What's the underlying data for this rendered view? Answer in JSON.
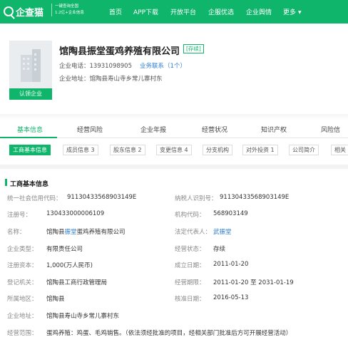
{
  "nav": {
    "logo_text": "企查猫",
    "logo_sub_line1": "一键查询全国",
    "logo_sub_line2": "1.2亿+企业信息",
    "items": [
      "首页",
      "APP下载",
      "开放平台",
      "企服优选",
      "企业舆情",
      "更多"
    ]
  },
  "header": {
    "company_name": "馆陶县振堂蛋鸡养殖有限公司",
    "status_tag": "[存续]",
    "phone_label": "企业电话：",
    "phone": "13931098905",
    "biz_contact": "业务联系（1个）",
    "address_label": "企业地址：",
    "address": "馆陶县寿山寺乡常儿寨村东",
    "claim_button": "认领企业"
  },
  "tabs": [
    "基本信息",
    "经营风险",
    "企业年报",
    "经营状况",
    "知识产权",
    "风险信"
  ],
  "subtabs": [
    "工商基本信息",
    "成员信息 3",
    "股东信息 2",
    "变更信息 4",
    "分支机构",
    "对外投资 1",
    "公司简介",
    "相关"
  ],
  "section_title": "工商基本信息",
  "fields": {
    "credit_code_label": "统一社会信用代码：",
    "credit_code": "91130433568903149E",
    "taxpayer_label": "纳税人识别号：",
    "taxpayer": "91130433568903149E",
    "reg_no_label": "注册号：",
    "reg_no": "130433000006109",
    "org_code_label": "机构代码：",
    "org_code": "568903149",
    "name_label": "名称：",
    "name_pre": "馆陶县",
    "name_link": "振堂",
    "name_post": "蛋鸡养殖有限公司",
    "legal_label": "法定代表人：",
    "legal": "武振堂",
    "type_label": "企业类型：",
    "type": "有限责任公司",
    "status_label": "经营状态：",
    "status": "存续",
    "capital_label": "注册资本：",
    "capital": "1,000(万人民币)",
    "founded_label": "成立日期：",
    "founded": "2011-01-20",
    "authority_label": "登记机关：",
    "authority": "馆陶县工商行政管理局",
    "term_label": "经营期限：",
    "term": "2011-01-20 至 2031-01-19",
    "region_label": "所属地区：",
    "region": "馆陶县",
    "approved_label": "核准日期：",
    "approved": "2016-05-13",
    "addr_label": "企业地址：",
    "addr": "馆陶县寿山寺乡常儿寨村东",
    "scope_label": "经营范围：",
    "scope": "蛋鸡养殖：鸡蛋、毛鸡销售。（依法须经批准的项目，经相关部门批准后方可开展经营活动）"
  }
}
